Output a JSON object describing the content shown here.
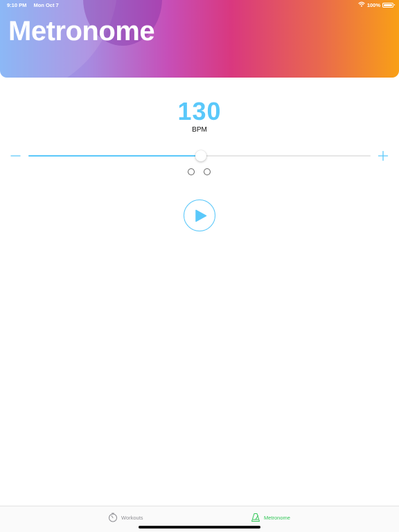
{
  "status_bar": {
    "time": "9:10 PM",
    "date": "Mon Oct 7",
    "battery": "100%",
    "icons": [
      "wifi-icon",
      "battery-icon"
    ]
  },
  "header": {
    "title": "Metronome",
    "gradient_colors": [
      "#7fb0f5",
      "#a78be0",
      "#c64fb8",
      "#d9387f",
      "#e9684e",
      "#f9a016"
    ]
  },
  "tempo": {
    "bpm_value": "130",
    "bpm_label": "BPM",
    "slider_fraction": 0.505,
    "decrease_icon": "minus-icon",
    "increase_icon": "plus-icon"
  },
  "beats": {
    "count": 2,
    "active_index": null
  },
  "controls": {
    "play_icon": "play-icon"
  },
  "tab_bar": {
    "tabs": [
      {
        "label": "Workouts",
        "icon": "stopwatch-icon",
        "selected": false
      },
      {
        "label": "Metronome",
        "icon": "metronome-icon",
        "selected": true
      }
    ]
  },
  "colors": {
    "accent": "#5ac8fa",
    "tab_selected": "#34c759",
    "tab_unselected": "#8e8e93"
  }
}
